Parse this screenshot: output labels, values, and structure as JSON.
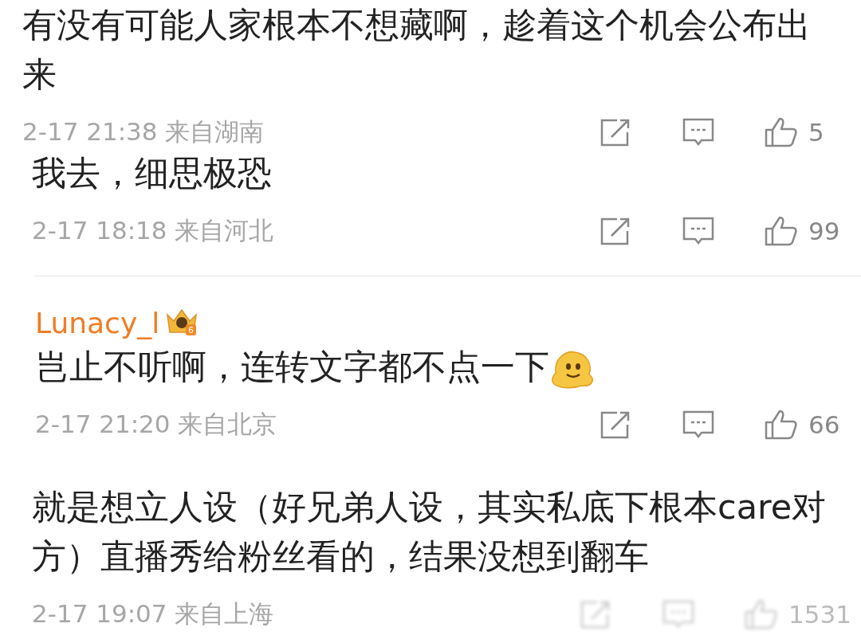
{
  "comments": [
    {
      "text": "有没有可能人家根本不想藏啊，趁着这个机会公布出来",
      "time": "2-17 21:38",
      "location": "来自湖南",
      "likes": "5",
      "blurred": false
    },
    {
      "text": "我去，细思极恐",
      "time": "2-17 18:18",
      "location": "来自河北",
      "likes": "99",
      "blurred": false
    },
    {
      "user": {
        "name": "Lunacy_l",
        "badge": "6"
      },
      "text": "岂止不听啊，连转文字都不点一下",
      "emoji": true,
      "time": "2-17 21:20",
      "location": "来自北京",
      "likes": "66",
      "blurred": false
    },
    {
      "text": "就是想立人设（好兄弟人设，其实私底下根本care对方）直播秀给粉丝看的，结果没想到翻车",
      "time": "2-17 19:07",
      "location": "来自上海",
      "likes": "1531",
      "blurred": true
    }
  ]
}
